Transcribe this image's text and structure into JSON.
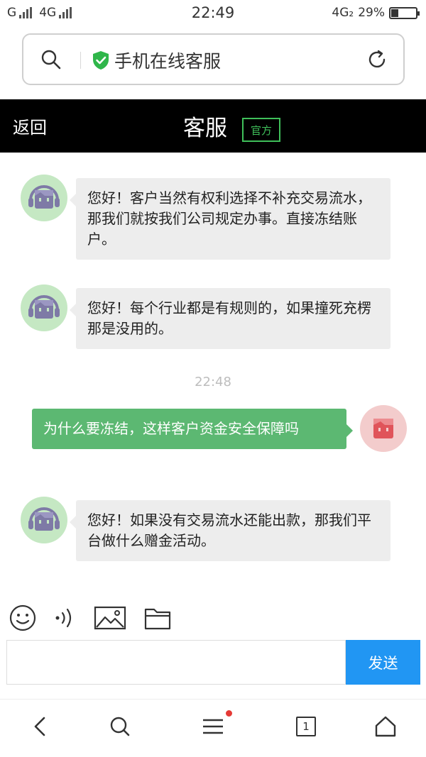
{
  "status_bar": {
    "carrier1": "G",
    "carrier2": "4G",
    "time": "22:49",
    "network_right": "4G₂",
    "battery_percent": "29%",
    "battery_level": 0.29
  },
  "browser": {
    "url_title": "手机在线客服"
  },
  "header": {
    "back_label": "返回",
    "title": "客服",
    "badge": "官方"
  },
  "messages": [
    {
      "from": "agent",
      "text": "您好！客户当然有权利选择不补充交易流水，那我们就按我们公司规定办事。直接冻结账户。"
    },
    {
      "from": "agent",
      "text": "您好！每个行业都是有规则的，如果撞死充楞那是没用的。"
    },
    {
      "from": "user",
      "text": "为什么要冻结，这样客户资金安全保障吗"
    },
    {
      "from": "agent",
      "text": "您好！如果没有交易流水还能出款，那我们平台做什么赠金活动。"
    }
  ],
  "timestamp": "22:48",
  "input": {
    "value": "",
    "send_label": "发送"
  },
  "bottom_nav": {
    "tab_count": "1"
  },
  "colors": {
    "header_bg": "#000000",
    "accent_green": "#5cb872",
    "send_blue": "#2196f3",
    "badge_green": "#3fbf5a"
  }
}
